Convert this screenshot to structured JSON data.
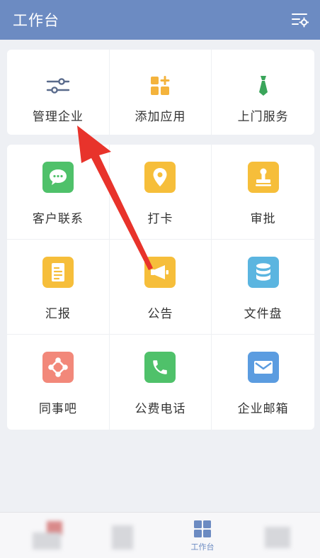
{
  "header": {
    "title": "工作台"
  },
  "top_items": [
    {
      "label": "管理企业",
      "icon": "sliders-icon"
    },
    {
      "label": "添加应用",
      "icon": "add-app-icon"
    },
    {
      "label": "上门服务",
      "icon": "tie-icon"
    }
  ],
  "main_items": [
    {
      "label": "客户联系",
      "icon": "chat-bubble-icon",
      "color": "#4fc16a"
    },
    {
      "label": "打卡",
      "icon": "location-pin-icon",
      "color": "#f6be3a"
    },
    {
      "label": "审批",
      "icon": "stamp-icon",
      "color": "#f6be3a"
    },
    {
      "label": "汇报",
      "icon": "document-icon",
      "color": "#f6be3a"
    },
    {
      "label": "公告",
      "icon": "megaphone-icon",
      "color": "#f6be3a"
    },
    {
      "label": "文件盘",
      "icon": "database-icon",
      "color": "#5bb5e0"
    },
    {
      "label": "同事吧",
      "icon": "network-icon",
      "color": "#f2887a"
    },
    {
      "label": "公费电话",
      "icon": "phone-icon",
      "color": "#4fc16a"
    },
    {
      "label": "企业邮箱",
      "icon": "mail-icon",
      "color": "#5b9ce0"
    }
  ],
  "bottom_nav": {
    "active_label": "工作台"
  },
  "colors": {
    "header": "#6c8bc2",
    "annotation_arrow": "#e8332b"
  }
}
